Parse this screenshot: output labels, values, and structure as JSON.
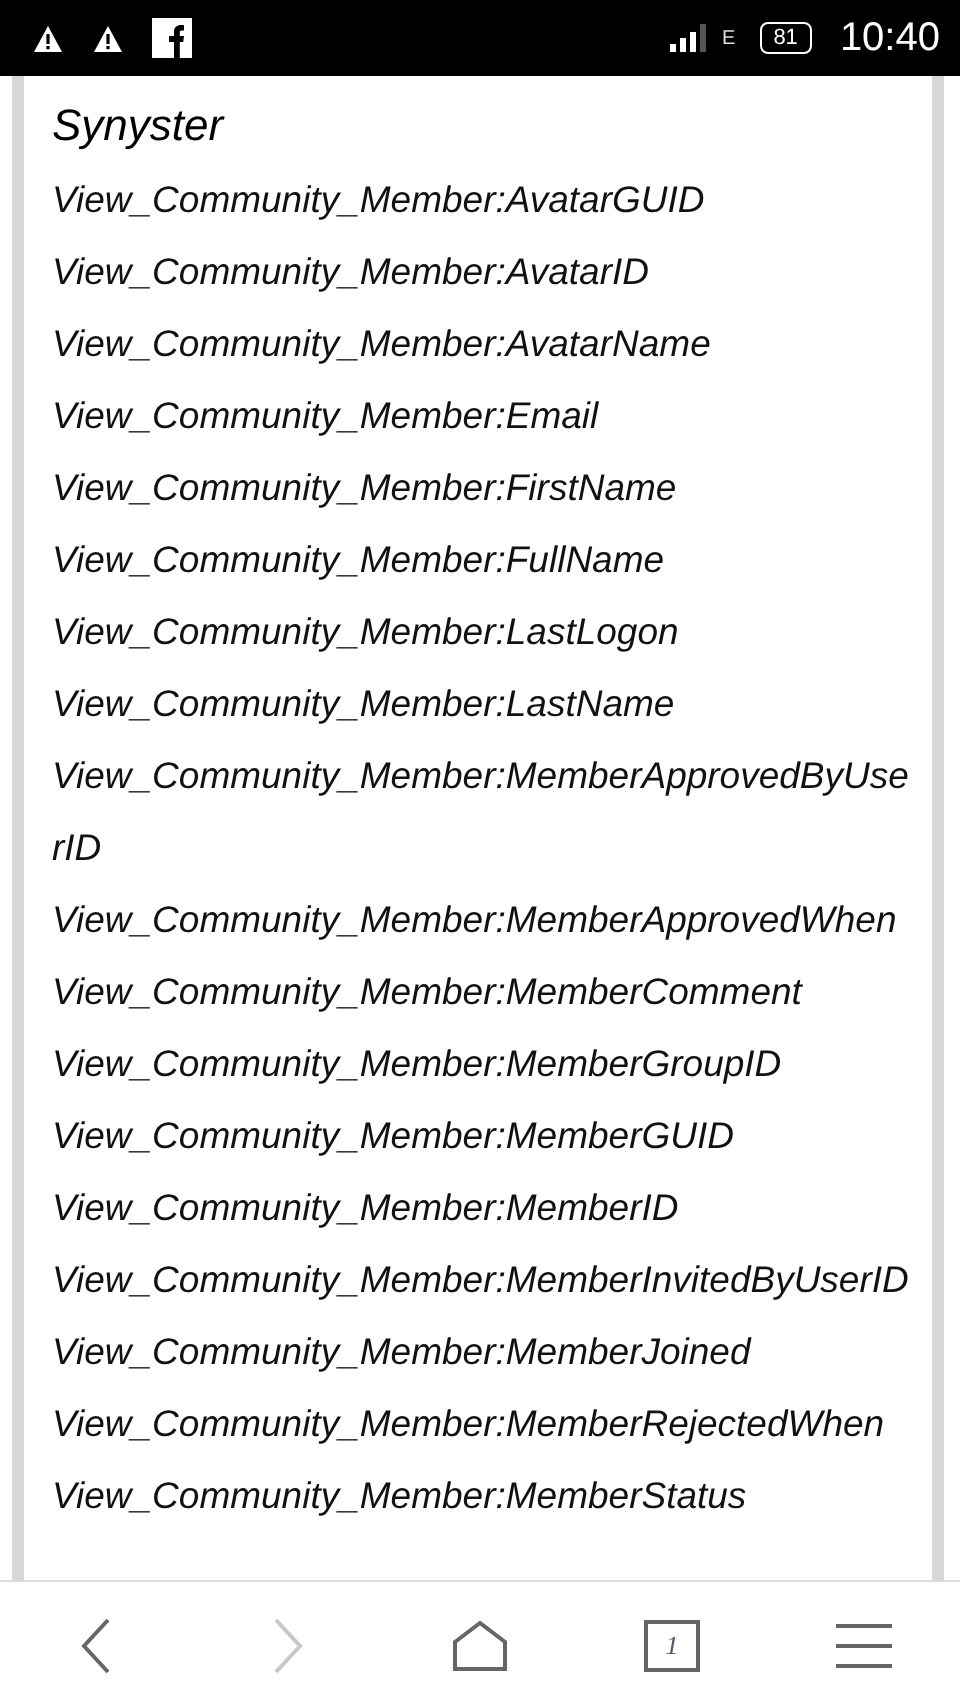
{
  "status_bar": {
    "network_type": "E",
    "battery": "81",
    "time": "10:40"
  },
  "page": {
    "title": "Synyster",
    "lines": [
      "View_Community_Member:AvatarGUID",
      "View_Community_Member:AvatarID",
      "View_Community_Member:AvatarName",
      "View_Community_Member:Email",
      "View_Community_Member:FirstName",
      "View_Community_Member:FullName",
      "View_Community_Member:LastLogon",
      "View_Community_Member:LastName",
      "View_Community_Member:MemberApprovedByUserID",
      "View_Community_Member:MemberApprovedWhen",
      "View_Community_Member:MemberComment",
      "View_Community_Member:MemberGroupID",
      "View_Community_Member:MemberGUID",
      "View_Community_Member:MemberID",
      "View_Community_Member:MemberInvitedByUserID",
      "View_Community_Member:MemberJoined",
      "View_Community_Member:MemberRejectedWhen",
      "View_Community_Member:MemberStatus"
    ]
  },
  "bottom_bar": {
    "back_disabled": false,
    "forward_disabled": true,
    "tab_count": "1"
  }
}
